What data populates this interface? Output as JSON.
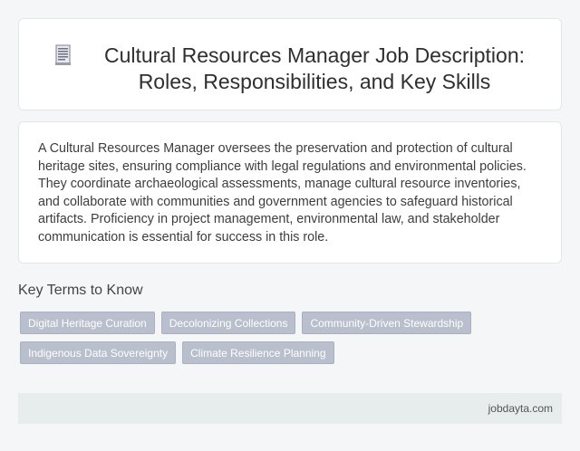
{
  "header": {
    "icon": "document-icon",
    "title": "Cultural Resources Manager Job Description: Roles, Responsibilities, and Key Skills"
  },
  "description": {
    "text": "A Cultural Resources Manager oversees the preservation and protection of cultural heritage sites, ensuring compliance with legal regulations and environmental policies. They coordinate archaeological assessments, manage cultural resource inventories, and collaborate with communities and government agencies to safeguard historical artifacts. Proficiency in project management, environmental law, and stakeholder communication is essential for success in this role."
  },
  "key_terms": {
    "heading": "Key Terms to Know",
    "tags": [
      "Digital Heritage Curation",
      "Decolonizing Collections",
      "Community-Driven Stewardship",
      "Indigenous Data Sovereignty",
      "Climate Resilience Planning"
    ]
  },
  "footer": {
    "site": "jobdayta.com"
  },
  "colors": {
    "background": "#f4f6f8",
    "tag_background": "#b9bfcc",
    "footer_background": "#e7ecec"
  }
}
